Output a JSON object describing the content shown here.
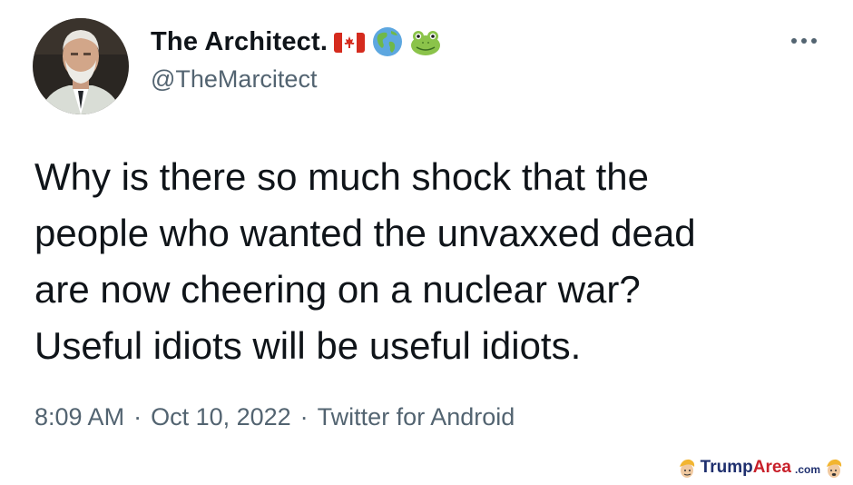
{
  "tweet": {
    "author": {
      "display_name": "The Architect.",
      "handle": "@TheMarcitect",
      "name_emojis": [
        "canada-flag-icon",
        "globe-americas-icon",
        "frog-face-icon"
      ]
    },
    "text": "Why is there so much shock that the\npeople who wanted the unvaxxed dead\nare now cheering on a nuclear war?\nUseful idiots will be useful idiots.",
    "time": "8:09 AM",
    "date": "Oct 10, 2022",
    "source": "Twitter for Android",
    "separator": "·"
  },
  "watermark": {
    "brand_part1": "Trump",
    "brand_part2": "Area",
    "suffix": ".com"
  },
  "colors": {
    "text_primary": "#0f1419",
    "text_secondary": "#536471",
    "watermark_blue": "#1e2f6e",
    "watermark_red": "#c8202a"
  }
}
